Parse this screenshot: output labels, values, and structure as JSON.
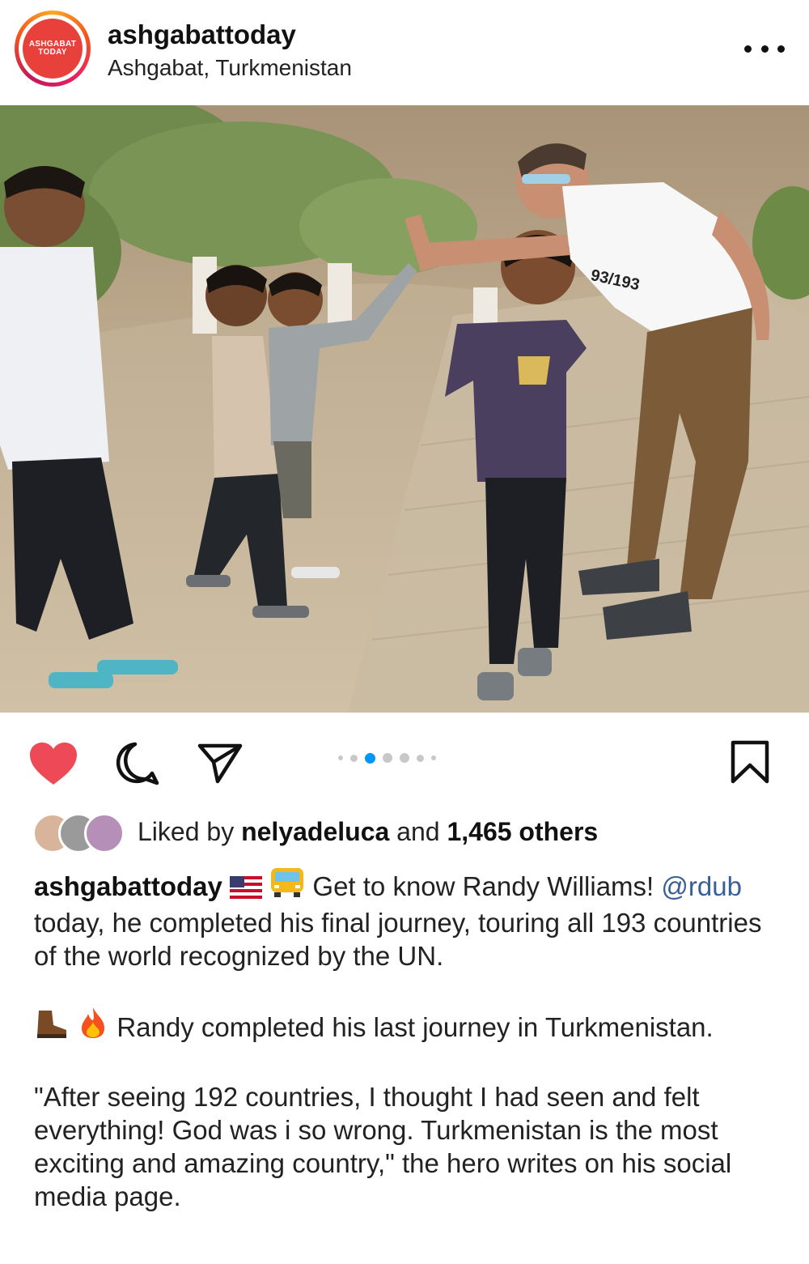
{
  "header": {
    "avatar_text_line1": "ASHGABAT",
    "avatar_text_line2": "TODAY",
    "username": "ashgabattoday",
    "location": "Ashgabat, Turkmenistan"
  },
  "photo": {
    "shirt_text": "93/193"
  },
  "carousel": {
    "dots": 7,
    "active_index": 2
  },
  "likes": {
    "prefix": "Liked by",
    "user": "nelyadeluca",
    "middle": "and",
    "count": "1,465 others"
  },
  "caption": {
    "username": "ashgabattoday",
    "line1_text": "Get to know Randy Williams!",
    "mention": "@rdub",
    "line1_rest": "today, he completed his final journey, touring all 193 countries of the world recognized by the UN.",
    "para2": "Randy completed his last journey in Turkmenistan.",
    "para3": "\"After seeing 192 countries, I thought I had seen and felt everything! God was i so wrong. Turkmenistan is the most exciting and amazing country,\" the hero writes on his social media page."
  },
  "colors": {
    "heart": "#ed4956",
    "active_dot": "#0095f6",
    "mention": "#3a5f94"
  }
}
